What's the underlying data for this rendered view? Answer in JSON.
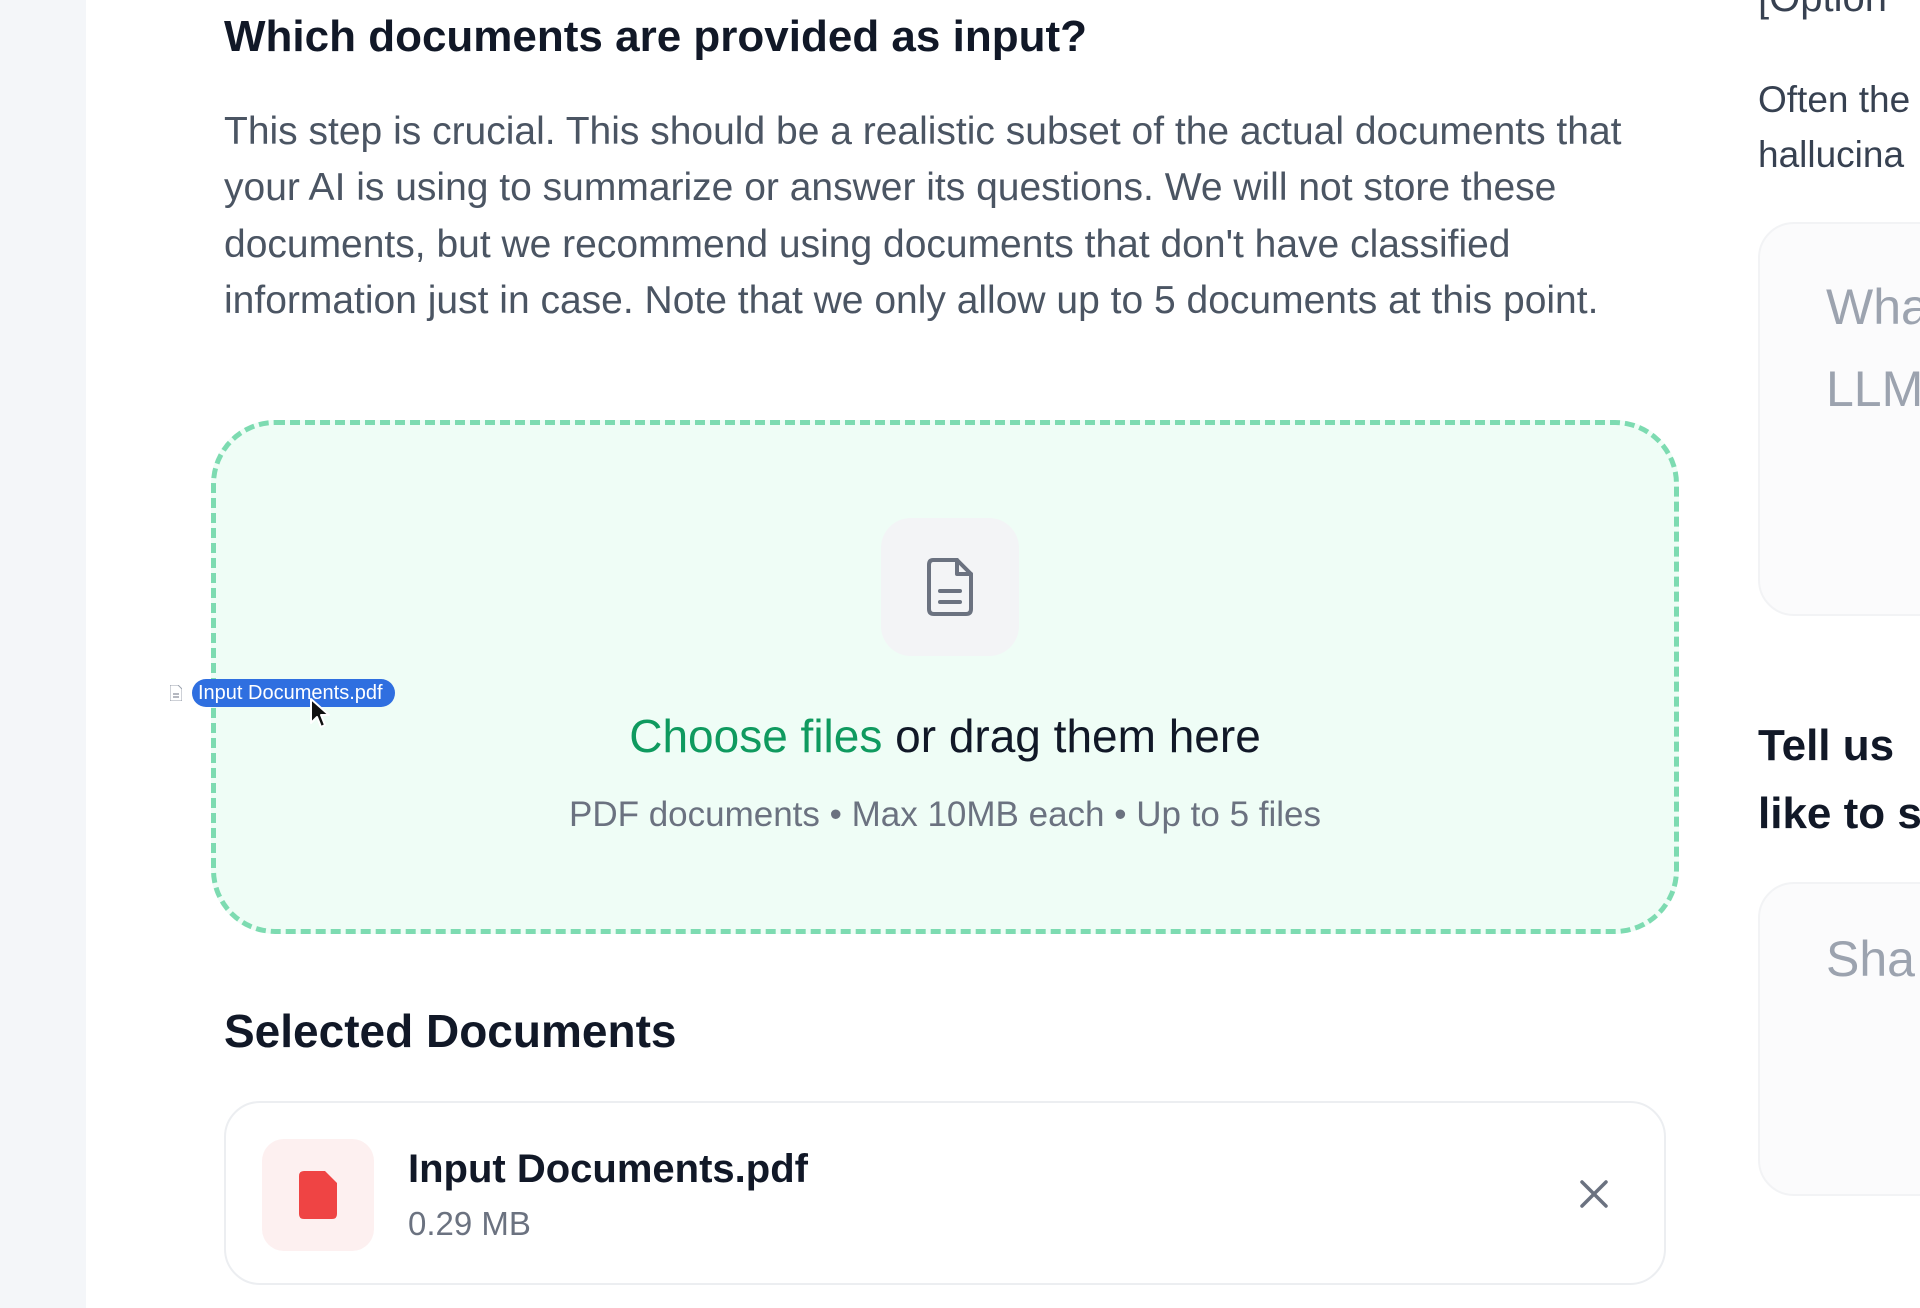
{
  "section": {
    "title": "Which documents are provided as input?",
    "description": "This step is crucial. This should be a realistic subset of the actual documents that your AI is using to summarize or answer its questions. We will not store these documents, but we recommend using documents that don't have classified information just in case. Note that we only allow up to 5 documents at this point."
  },
  "dropzone": {
    "choose_label": "Choose files",
    "drag_label": " or drag them here",
    "hint": "PDF documents • Max 10MB each • Up to 5 files",
    "icon": "document-icon"
  },
  "drag_ghost": {
    "label": "Input Documents.pdf",
    "icon": "file-icon"
  },
  "selected": {
    "title": "Selected Documents",
    "files": [
      {
        "name": "Input Documents.pdf",
        "size": "0.29 MB",
        "icon": "pdf-file-icon"
      }
    ]
  },
  "right_column": {
    "optional_heading": "[Option",
    "help_line1": "Often the",
    "help_line2": "hallucina",
    "placeholder1_line1": "Wha",
    "placeholder1_line2": "LLM",
    "question_line1": "Tell us",
    "question_line2": "like to s",
    "placeholder2": "Sha"
  },
  "colors": {
    "accent": "#0f9a5f",
    "dropzone_border": "#7ddbb1",
    "dropzone_bg": "#effdf6",
    "pdf_red": "#ef4444",
    "drag_label_bg": "#2f6fe0"
  }
}
